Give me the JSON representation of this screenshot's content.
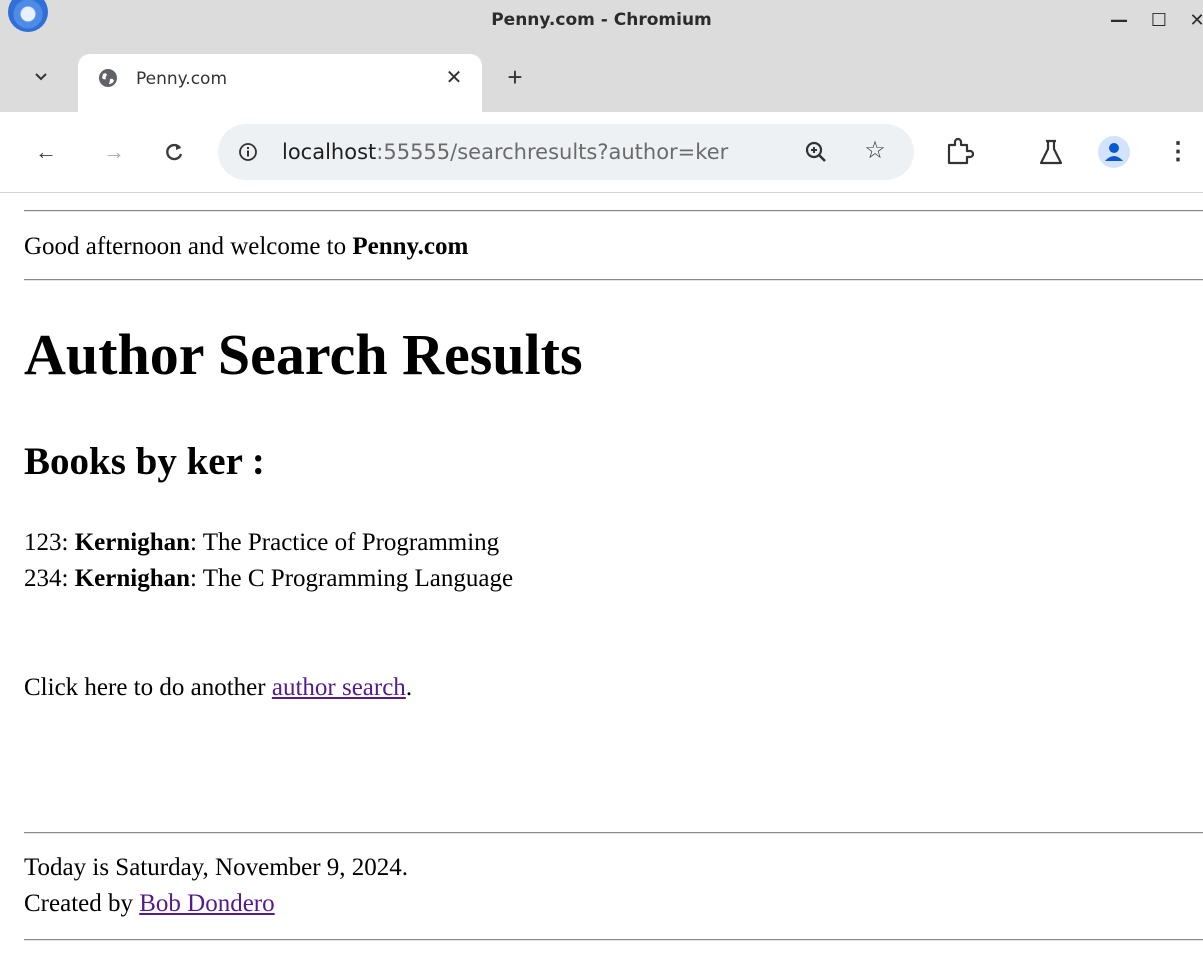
{
  "window": {
    "title": "Penny.com - Chromium",
    "minimize_glyph": "—",
    "maximize_glyph": "☐",
    "close_glyph": "✕"
  },
  "tabs": [
    {
      "title": "Penny.com",
      "favicon": "globe-icon",
      "active": true
    }
  ],
  "tabstrip": {
    "tab_search_glyph": "⌄",
    "close_glyph": "✕",
    "new_tab_glyph": "+"
  },
  "toolbar": {
    "back_glyph": "←",
    "forward_glyph": "→",
    "reload_glyph": "C",
    "site_info_glyph": "ⓘ",
    "star_glyph": "☆",
    "menu_glyph": "⋮",
    "url_host": "localhost",
    "url_rest": ":55555/searchresults?author=ker"
  },
  "page": {
    "greeting_prefix": "Good afternoon and welcome to ",
    "greeting_site": "Penny.com",
    "title": "Author Search Results",
    "subtitle": "Books by ker :",
    "results": [
      {
        "isbn": "123",
        "sep1": ": ",
        "author": "Kernighan",
        "sep2": ": ",
        "title": "The Practice of Programming"
      },
      {
        "isbn": "234",
        "sep1": ": ",
        "author": "Kernighan",
        "sep2": ": ",
        "title": "The C Programming Language"
      }
    ],
    "another_prefix": "Click here to do another ",
    "another_link": "author search",
    "another_suffix": ".",
    "footer_date": "Today is Saturday, November 9, 2024.",
    "footer_created_prefix": "Created by ",
    "footer_author_link": "Bob Dondero"
  },
  "colors": {
    "link_visited": "#551a8b",
    "chrome_frame": "#dcdcdc",
    "omnibox_bg": "#eef1f4",
    "profile_blue": "#0b57d0"
  }
}
